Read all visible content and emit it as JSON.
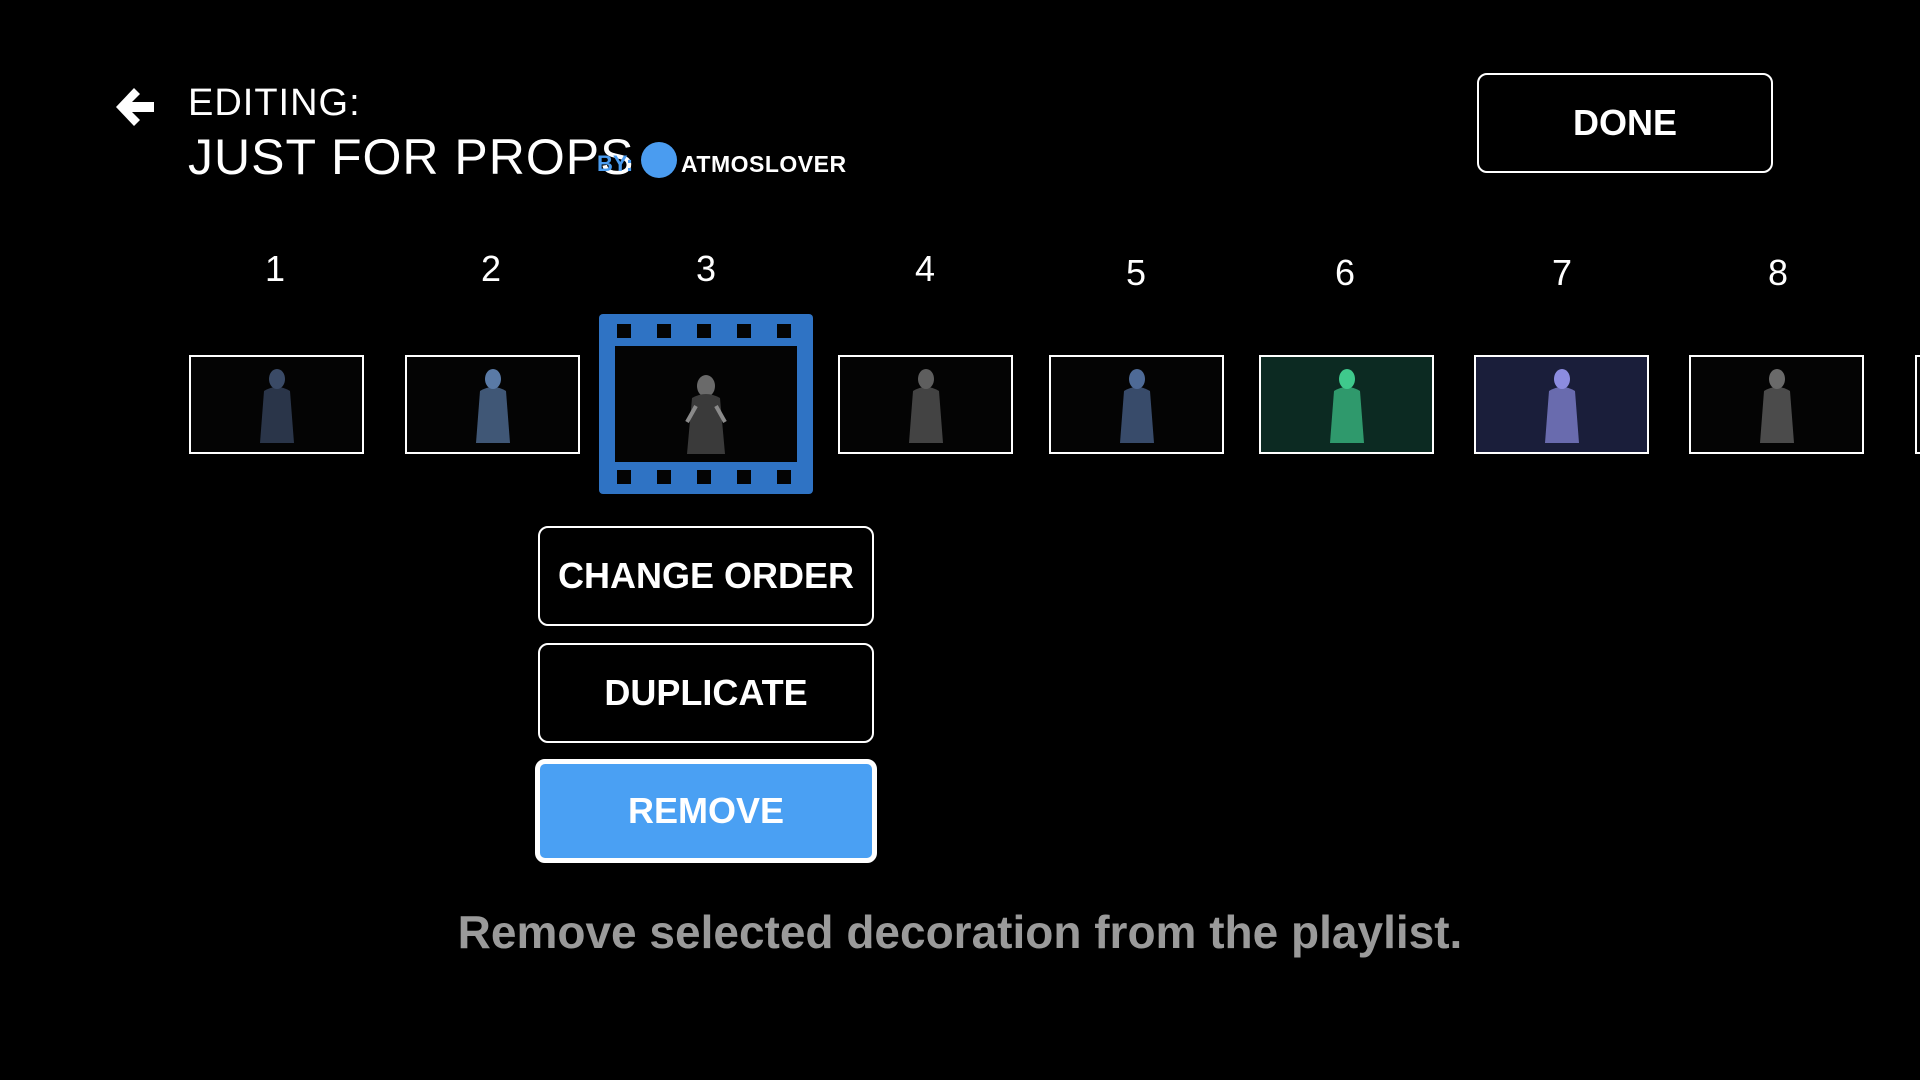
{
  "header": {
    "editing_label": "EDITING:",
    "playlist_title": "JUST FOR PROPS",
    "by_label": "BY:",
    "author": "ATMOSLOVER",
    "back_icon": "back-arrow-icon",
    "avatar_color": "#4a9cf0"
  },
  "done_label": "DONE",
  "playlist": {
    "selected_index": 3,
    "items": [
      {
        "number": "1",
        "tint": "#3a4a66"
      },
      {
        "number": "2",
        "tint": "#5a7aa6"
      },
      {
        "number": "3",
        "tint": "#6a6a6a"
      },
      {
        "number": "4",
        "tint": "#5e5e5e"
      },
      {
        "number": "5",
        "tint": "#4e6a96"
      },
      {
        "number": "6",
        "tint": "#3fc98c"
      },
      {
        "number": "7",
        "tint": "#8c8ce0"
      },
      {
        "number": "8",
        "tint": "#6a6a6a"
      }
    ]
  },
  "actions": {
    "change_order": "CHANGE ORDER",
    "duplicate": "DUPLICATE",
    "remove": "REMOVE"
  },
  "hint_text": "Remove selected decoration from the playlist.",
  "colors": {
    "accent": "#4aa0f3",
    "hint": "#9a9a9a"
  }
}
